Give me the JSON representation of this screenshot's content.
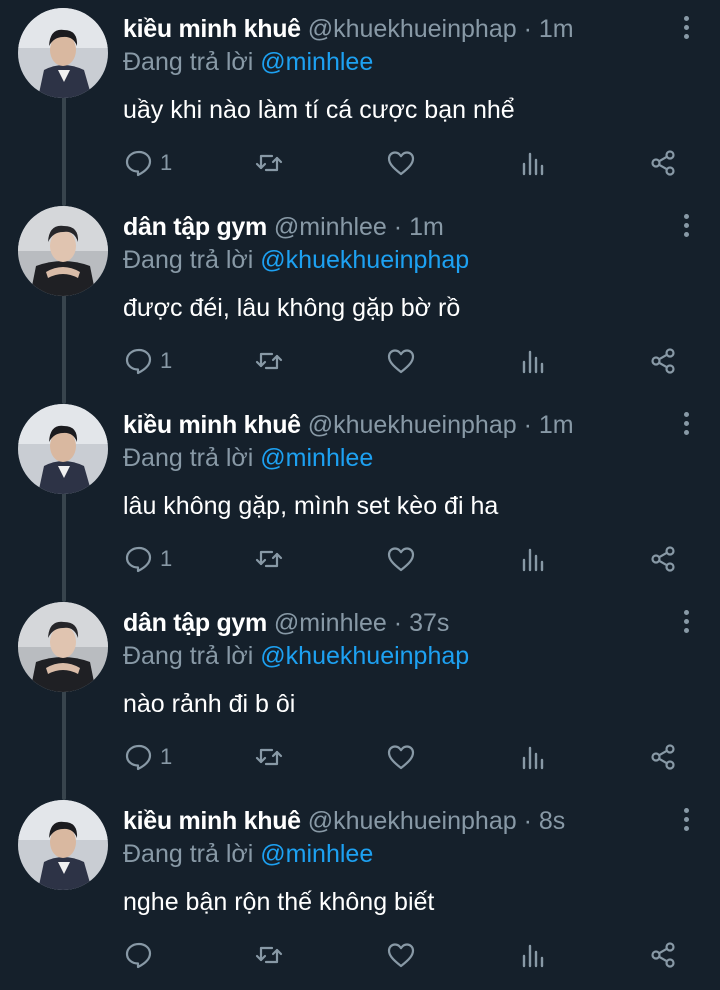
{
  "colors": {
    "background": "#15202b",
    "text_primary": "#ffffff",
    "text_secondary": "#8899a6",
    "link": "#1da1f2",
    "thread_line": "#38444d"
  },
  "icons": {
    "reply": "comment-bubble-icon",
    "retweet": "retweet-icon",
    "like": "heart-icon",
    "stats": "bar-chart-icon",
    "share": "share-icon",
    "more": "vertical-ellipsis-icon"
  },
  "tweets": [
    {
      "name": "kiều minh khuê",
      "handle": "@khuekhueinphap",
      "dot": "·",
      "time": "1m",
      "reply_prefix": "Đang trả lời",
      "reply_to": "@minhlee",
      "text": "uầy khi nào làm tí cá cược bạn nhể",
      "reply_count": "1"
    },
    {
      "name": "dân tập gym",
      "handle": "@minhlee",
      "dot": "·",
      "time": "1m",
      "reply_prefix": "Đang trả lời",
      "reply_to": "@khuekhueinphap",
      "text": "được đéi, lâu không gặp bờ rồ",
      "reply_count": "1"
    },
    {
      "name": "kiều minh khuê",
      "handle": "@khuekhueinphap",
      "dot": "·",
      "time": "1m",
      "reply_prefix": "Đang trả lời",
      "reply_to": "@minhlee",
      "text": "lâu không gặp, mình set kèo đi ha",
      "reply_count": "1"
    },
    {
      "name": "dân tập gym",
      "handle": "@minhlee",
      "dot": "·",
      "time": "37s",
      "reply_prefix": "Đang trả lời",
      "reply_to": "@khuekhueinphap",
      "text": "nào rảnh đi b ôi",
      "reply_count": "1"
    },
    {
      "name": "kiều minh khuê",
      "handle": "@khuekhueinphap",
      "dot": "·",
      "time": "8s",
      "reply_prefix": "Đang trả lời",
      "reply_to": "@minhlee",
      "text": "nghe bận rộn thế không biết",
      "reply_count": ""
    }
  ]
}
